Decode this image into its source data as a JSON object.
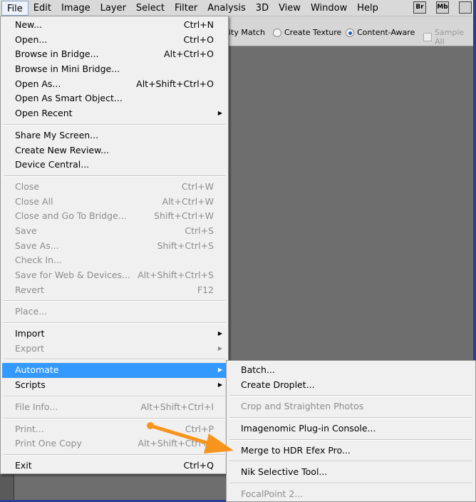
{
  "menubar": [
    "File",
    "Edit",
    "Image",
    "Layer",
    "Select",
    "Filter",
    "Analysis",
    "3D",
    "View",
    "Window",
    "Help"
  ],
  "bridge_icons": [
    "Br",
    "Mb"
  ],
  "options": {
    "partial": "nity Match",
    "create_texture": "Create Texture",
    "content_aware": "Content-Aware",
    "sample_all": "Sample All",
    "selected": "Content-Aware"
  },
  "file_menu": [
    {
      "label": "New...",
      "shortcut": "Ctrl+N"
    },
    {
      "label": "Open...",
      "shortcut": "Ctrl+O"
    },
    {
      "label": "Browse in Bridge...",
      "shortcut": "Alt+Ctrl+O"
    },
    {
      "label": "Browse in Mini Bridge..."
    },
    {
      "label": "Open As...",
      "shortcut": "Alt+Shift+Ctrl+O"
    },
    {
      "label": "Open As Smart Object..."
    },
    {
      "label": "Open Recent",
      "submenu": true
    },
    {
      "sep": true
    },
    {
      "label": "Share My Screen..."
    },
    {
      "label": "Create New Review..."
    },
    {
      "label": "Device Central..."
    },
    {
      "sep": true
    },
    {
      "label": "Close",
      "shortcut": "Ctrl+W",
      "disabled": true
    },
    {
      "label": "Close All",
      "shortcut": "Alt+Ctrl+W",
      "disabled": true
    },
    {
      "label": "Close and Go To Bridge...",
      "shortcut": "Shift+Ctrl+W",
      "disabled": true
    },
    {
      "label": "Save",
      "shortcut": "Ctrl+S",
      "disabled": true
    },
    {
      "label": "Save As...",
      "shortcut": "Shift+Ctrl+S",
      "disabled": true
    },
    {
      "label": "Check In...",
      "disabled": true
    },
    {
      "label": "Save for Web & Devices...",
      "shortcut": "Alt+Shift+Ctrl+S",
      "disabled": true
    },
    {
      "label": "Revert",
      "shortcut": "F12",
      "disabled": true
    },
    {
      "sep": true
    },
    {
      "label": "Place...",
      "disabled": true
    },
    {
      "sep": true
    },
    {
      "label": "Import",
      "submenu": true
    },
    {
      "label": "Export",
      "submenu": true,
      "disabled": true
    },
    {
      "sep": true
    },
    {
      "label": "Automate",
      "submenu": true,
      "highlighted": true
    },
    {
      "label": "Scripts",
      "submenu": true
    },
    {
      "sep": true
    },
    {
      "label": "File Info...",
      "shortcut": "Alt+Shift+Ctrl+I",
      "disabled": true
    },
    {
      "sep": true
    },
    {
      "label": "Print...",
      "shortcut": "Ctrl+P",
      "disabled": true
    },
    {
      "label": "Print One Copy",
      "shortcut": "Alt+Shift+Ctrl+P",
      "disabled": true
    },
    {
      "sep": true
    },
    {
      "label": "Exit",
      "shortcut": "Ctrl+Q"
    }
  ],
  "automate_menu": [
    {
      "label": "Batch..."
    },
    {
      "label": "Create Droplet..."
    },
    {
      "sep": true
    },
    {
      "label": "Crop and Straighten Photos",
      "disabled": true
    },
    {
      "sep": true
    },
    {
      "label": "Imagenomic Plug-in Console..."
    },
    {
      "sep": true
    },
    {
      "label": "Merge to HDR Efex Pro..."
    },
    {
      "sep": true
    },
    {
      "label": "Nik Selective Tool..."
    },
    {
      "sep": true
    },
    {
      "label": "FocalPoint 2...",
      "disabled": true
    }
  ],
  "colors": {
    "highlight": "#3399ff",
    "annotation_arrow": "#f7941d"
  }
}
